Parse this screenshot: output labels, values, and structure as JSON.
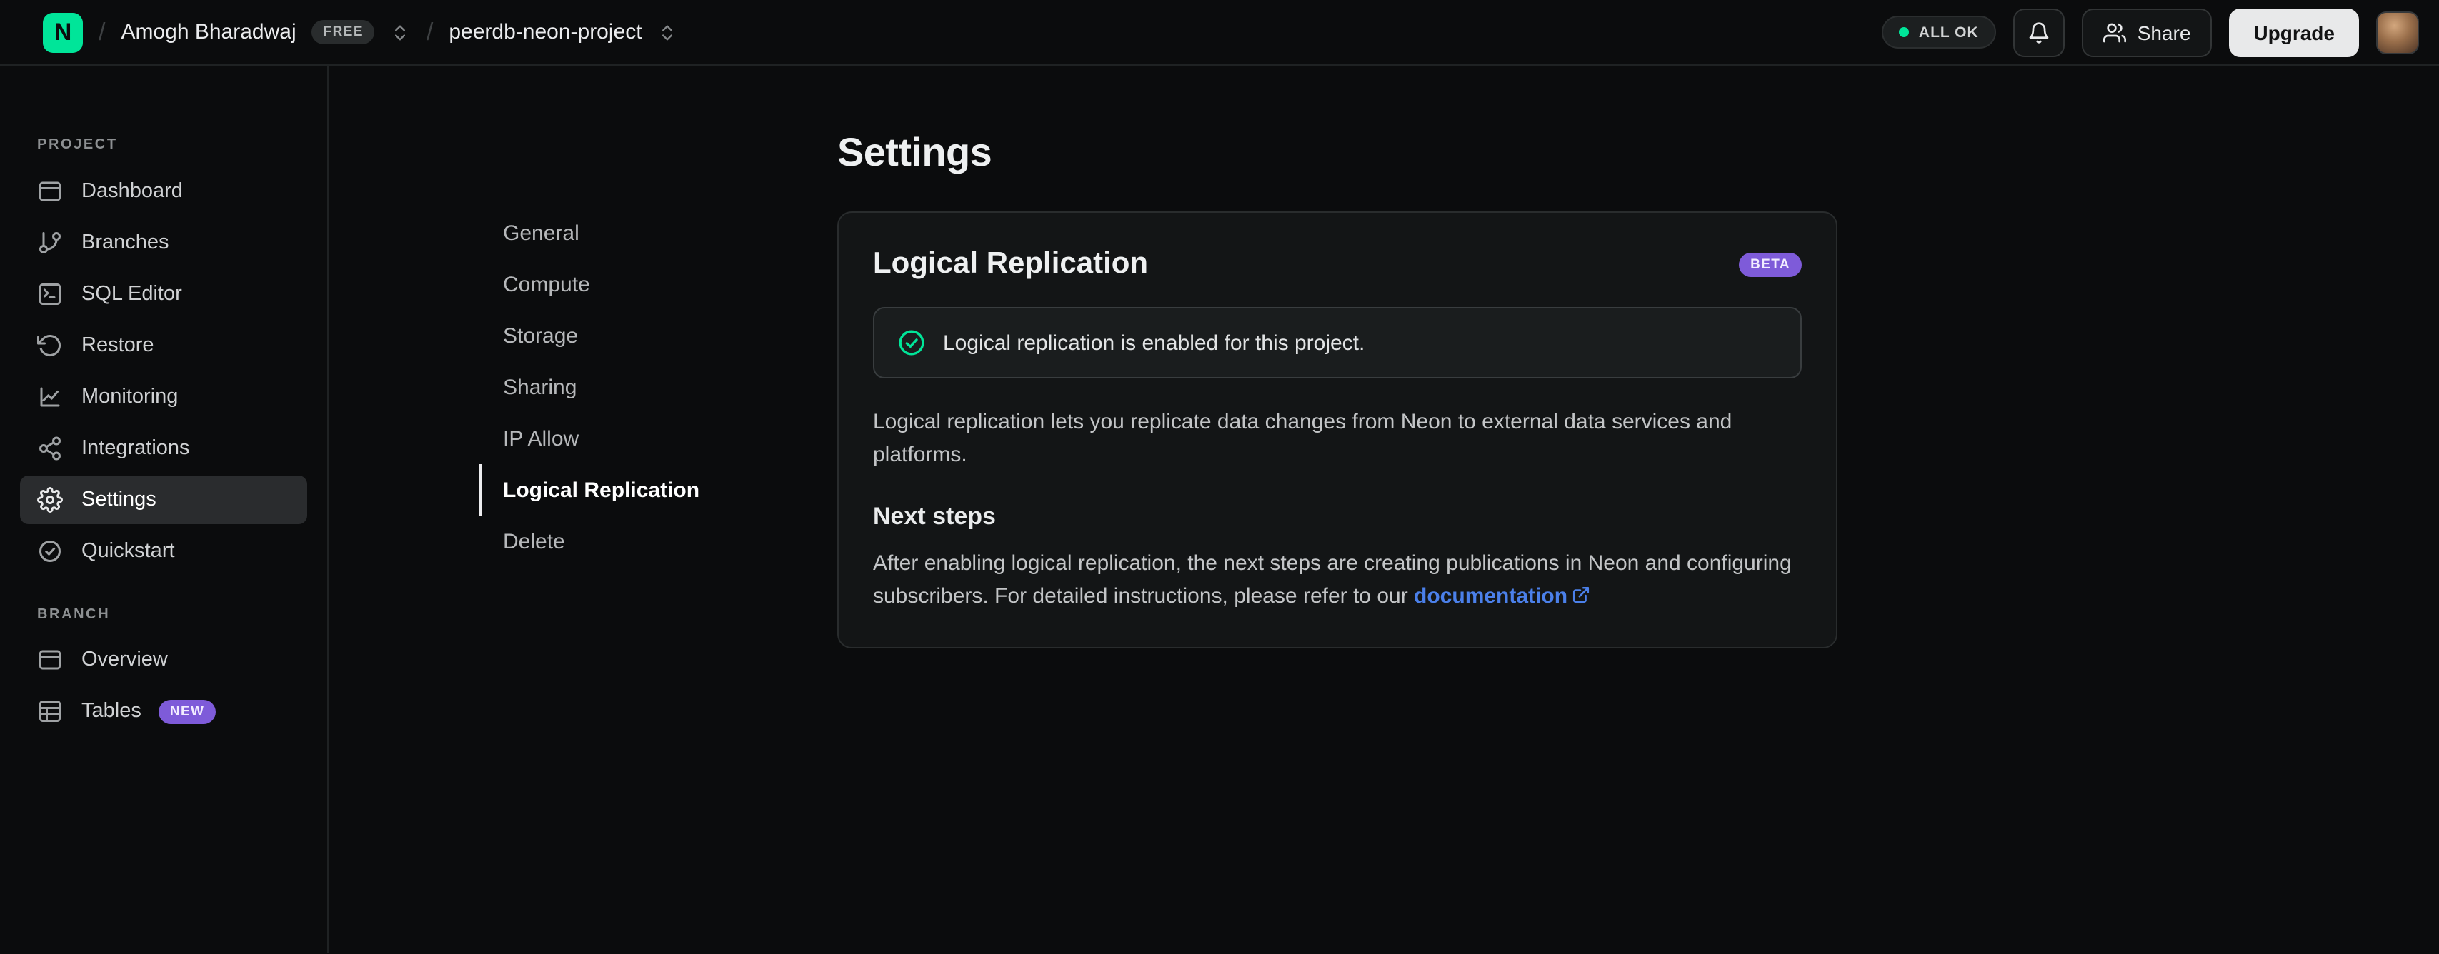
{
  "topbar": {
    "logo_letter": "N",
    "breadcrumb": {
      "org_name": "Amogh Bharadwaj",
      "org_badge": "FREE",
      "project_name": "peerdb-neon-project"
    },
    "status_pill": "ALL OK",
    "share_label": "Share",
    "upgrade_label": "Upgrade"
  },
  "sidebar": {
    "sections": [
      {
        "label": "PROJECT",
        "items": [
          {
            "label": "Dashboard",
            "icon": "dashboard-icon"
          },
          {
            "label": "Branches",
            "icon": "git-branch-icon"
          },
          {
            "label": "SQL Editor",
            "icon": "sql-editor-icon"
          },
          {
            "label": "Restore",
            "icon": "restore-icon"
          },
          {
            "label": "Monitoring",
            "icon": "monitoring-icon"
          },
          {
            "label": "Integrations",
            "icon": "integrations-icon"
          },
          {
            "label": "Settings",
            "icon": "gear-icon",
            "active": true
          },
          {
            "label": "Quickstart",
            "icon": "check-circle-icon"
          }
        ]
      },
      {
        "label": "BRANCH",
        "items": [
          {
            "label": "Overview",
            "icon": "overview-icon"
          },
          {
            "label": "Tables",
            "icon": "table-icon",
            "badge": "NEW"
          }
        ]
      }
    ]
  },
  "main": {
    "page_title": "Settings",
    "settings_nav": [
      {
        "label": "General"
      },
      {
        "label": "Compute"
      },
      {
        "label": "Storage"
      },
      {
        "label": "Sharing"
      },
      {
        "label": "IP Allow"
      },
      {
        "label": "Logical Replication",
        "active": true
      },
      {
        "label": "Delete"
      }
    ],
    "card": {
      "title": "Logical Replication",
      "badge": "BETA",
      "alert_text": "Logical replication is enabled for this project.",
      "description": "Logical replication lets you replicate data changes from Neon to external data services and platforms.",
      "next_steps_title": "Next steps",
      "next_steps_text": "After enabling logical replication, the next steps are creating publications in Neon and configuring subscribers. For detailed instructions, please refer to our ",
      "doc_link_label": "documentation"
    }
  },
  "colors": {
    "accent_green": "#00e599",
    "badge_purple": "#7e5bd9",
    "link_blue": "#4b80ea",
    "page_background": "#0b0c0d",
    "card_background": "#131516"
  }
}
